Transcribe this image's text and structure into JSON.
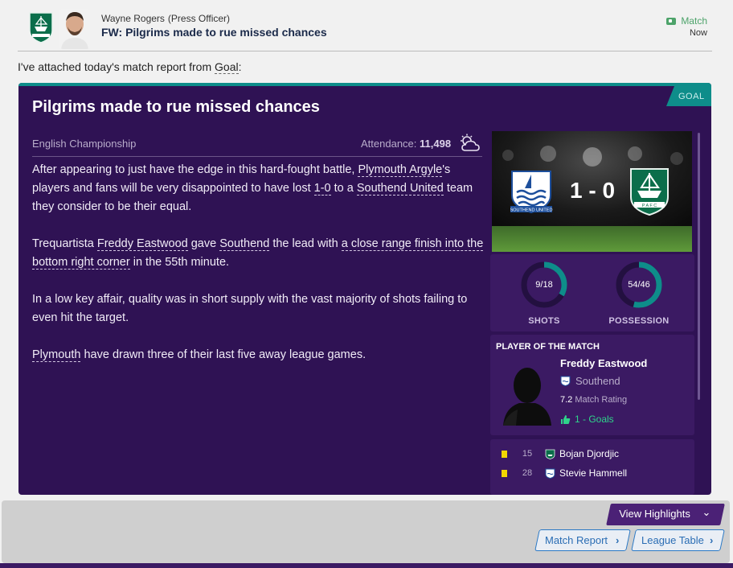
{
  "message": {
    "sender_name": "Wayne Rogers",
    "sender_role": "(Press Officer)",
    "subject": "FW: Pilgrims made to rue missed chances",
    "tag": "Match",
    "time": "Now",
    "intro_prefix": "I've attached today's match report from ",
    "intro_source": "Goal",
    "intro_suffix": ":"
  },
  "article": {
    "badge": "GOAL",
    "title": "Pilgrims made to rue missed chances",
    "competition": "English Championship",
    "attendance_label": "Attendance:",
    "attendance_value": "11,498",
    "weather_icon": "partly-cloudy-icon",
    "p1": {
      "a": "After appearing to just have the edge in this hard-fought battle, ",
      "team1": "Plymouth Argyle",
      "b": "'s players and fans will be very disappointed to have lost ",
      "score": "1-0",
      "c": " to a ",
      "team2": "Southend United",
      "d": " team they consider to be their equal."
    },
    "p2": {
      "a": "Trequartista ",
      "player": "Freddy Eastwood",
      "b": " gave ",
      "team": "Southend",
      "c": " the lead with ",
      "goal": "a close range finish into the bottom right corner",
      "d": " in the 55th minute."
    },
    "p3": "In a low key affair, quality was in short supply with the vast majority of shots failing to even hit the target.",
    "p4": {
      "team": "Plymouth",
      "a": " have drawn three of their last five away league games."
    }
  },
  "match": {
    "score": "1 - 0",
    "home_team": "Southend United",
    "away_team": "Plymouth Argyle",
    "home_crest_text": "SOUTHEND UNITED",
    "away_crest_text": "P A F C",
    "shots": {
      "label": "SHOTS",
      "home": 9,
      "away": 18,
      "text": "9/18"
    },
    "possession": {
      "label": "POSSESSION",
      "home": 54,
      "away": 46,
      "text": "54/46"
    }
  },
  "player_of_match": {
    "heading": "PLAYER OF THE MATCH",
    "name": "Freddy Eastwood",
    "club": "Southend",
    "rating": "7.2",
    "rating_label": "Match Rating",
    "goals": "1 - Goals"
  },
  "events": [
    {
      "type": "yellow-card",
      "minute": "15",
      "team": "Plymouth Argyle",
      "player": "Bojan Djordjic"
    },
    {
      "type": "yellow-card",
      "minute": "28",
      "team": "Southend United",
      "player": "Stevie Hammell"
    }
  ],
  "actions": {
    "highlights": "View Highlights",
    "match_report": "Match Report",
    "league_table": "League Table"
  },
  "colors": {
    "card_bg": "#2f1254",
    "accent_teal": "#0e8d8a",
    "panel_bg": "#3b1a63",
    "ring_green": "#0e8d8a",
    "goal_green": "#2fd48a",
    "yellow_card": "#f2d600"
  }
}
